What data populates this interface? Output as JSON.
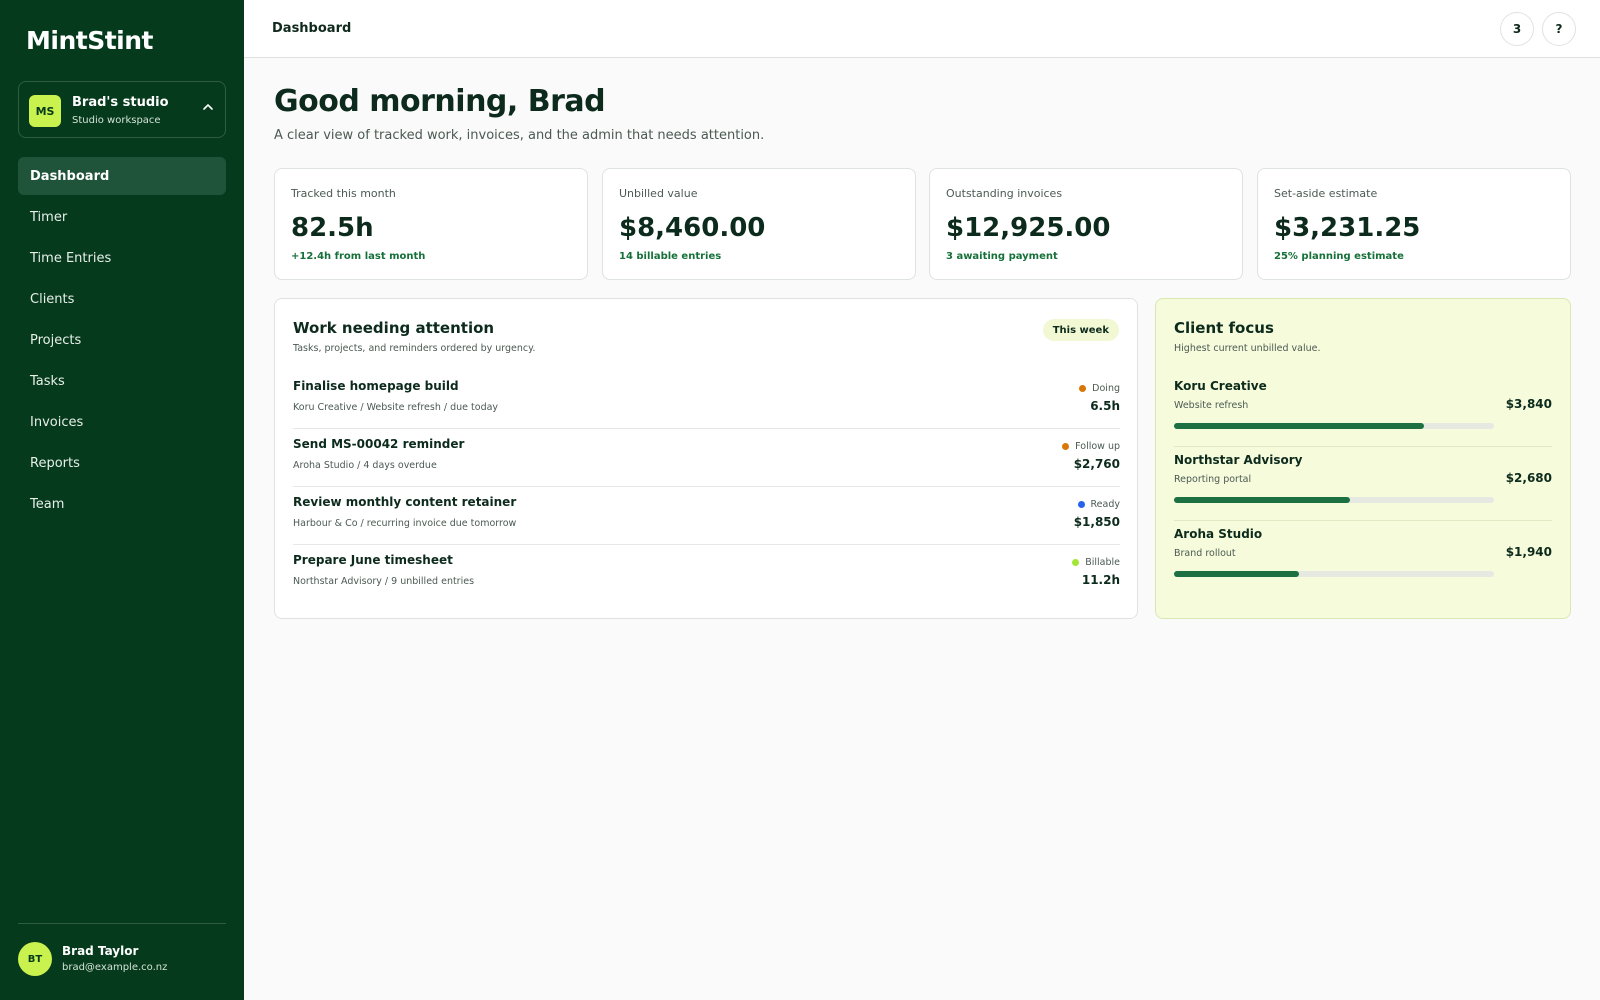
{
  "app": {
    "logo": "MintStint",
    "workspace": {
      "badge": "MS",
      "name": "Brad's studio",
      "subtitle": "Studio workspace"
    }
  },
  "sidebar": {
    "items": [
      {
        "label": "Dashboard",
        "active": true
      },
      {
        "label": "Timer"
      },
      {
        "label": "Time Entries"
      },
      {
        "label": "Clients"
      },
      {
        "label": "Projects"
      },
      {
        "label": "Tasks"
      },
      {
        "label": "Invoices"
      },
      {
        "label": "Reports"
      },
      {
        "label": "Team"
      }
    ]
  },
  "user": {
    "initials": "BT",
    "name": "Brad Taylor",
    "email": "brad@example.co.nz"
  },
  "topbar": {
    "title": "Dashboard",
    "notifications": "3",
    "help": "?"
  },
  "main": {
    "greeting": "Good morning, Brad",
    "subtitle": "A clear view of tracked work, invoices, and the admin that needs attention.",
    "stats": [
      {
        "label": "Tracked this month",
        "value": "82.5h",
        "note": "+12.4h from last month"
      },
      {
        "label": "Unbilled value",
        "value": "$8,460.00",
        "note": "14 billable entries"
      },
      {
        "label": "Outstanding invoices",
        "value": "$12,925.00",
        "note": "3 awaiting payment"
      },
      {
        "label": "Set-aside estimate",
        "value": "$3,231.25",
        "note": "25% planning estimate"
      }
    ]
  },
  "work": {
    "title": "Work needing attention",
    "subtitle": "Tasks, projects, and reminders ordered by urgency.",
    "pill": "This week",
    "items": [
      {
        "title": "Finalise homepage build",
        "meta": "Koru Creative / Website refresh / due today",
        "status": "Doing",
        "status_color": "#d97706",
        "value": "6.5h"
      },
      {
        "title": "Send MS-00042 reminder",
        "meta": "Aroha Studio / 4 days overdue",
        "status": "Follow up",
        "status_color": "#d97706",
        "value": "$2,760"
      },
      {
        "title": "Review monthly content retainer",
        "meta": "Harbour & Co / recurring invoice due tomorrow",
        "status": "Ready",
        "status_color": "#2563eb",
        "value": "$1,850"
      },
      {
        "title": "Prepare June timesheet",
        "meta": "Northstar Advisory / 9 unbilled entries",
        "status": "Billable",
        "status_color": "#a3e635",
        "value": "11.2h"
      }
    ]
  },
  "focus": {
    "title": "Client focus",
    "subtitle": "Highest current unbilled value.",
    "clients": [
      {
        "name": "Koru Creative",
        "project": "Website refresh",
        "value": "$3,840",
        "progress": 0.78
      },
      {
        "name": "Northstar Advisory",
        "project": "Reporting portal",
        "value": "$2,680",
        "progress": 0.55
      },
      {
        "name": "Aroha Studio",
        "project": "Brand rollout",
        "value": "$1,940",
        "progress": 0.39
      }
    ]
  },
  "colors": {
    "sidebar": "#063a1c",
    "accent": "#c9f24e",
    "positive": "#167039",
    "bar": "#1c7041"
  }
}
